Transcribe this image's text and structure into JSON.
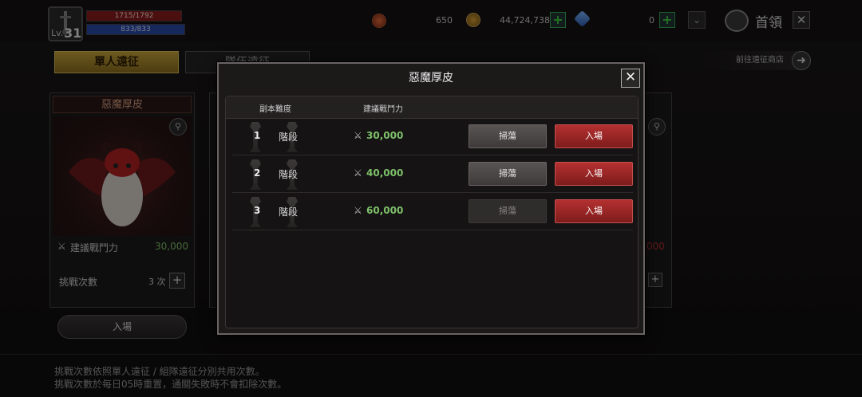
{
  "player": {
    "level_prefix": "Lv.",
    "level": "31",
    "hp": "1715/1792",
    "mp": "833/833"
  },
  "resources": [
    {
      "icon": "red-token-icon",
      "value": "650"
    },
    {
      "icon": "gold-coin-icon",
      "value": "44,724,738"
    },
    {
      "icon": "diamond-icon",
      "value": "0"
    }
  ],
  "header": {
    "home_label": "首領",
    "close_glyph": "✕"
  },
  "tabs": {
    "active": "單人遠征",
    "inactive": "隊伍遠征"
  },
  "shop_link": "前往遠征商店",
  "card": {
    "title": "惡魔厚皮",
    "power_label": "建議戰鬥力",
    "power_value": "30,000",
    "challenge_label": "挑戰次數",
    "challenge_value": "3 次",
    "enter_label": "入場"
  },
  "card3_power": "000",
  "footer_notes": [
    "挑戰次數依照單人遠征 / 組隊遠征分別共用次數。",
    "挑戰次數於每日05時重置，通關失敗時不會扣除次數。"
  ],
  "modal": {
    "title": "惡魔厚皮",
    "close_glyph": "✕",
    "headers": {
      "difficulty": "副本難度",
      "power": "建議戰鬥力"
    },
    "rows": [
      {
        "num": "1",
        "label": "階段",
        "power": "30,000",
        "sweep": "掃蕩",
        "enter": "入場",
        "sweep_enabled": true
      },
      {
        "num": "2",
        "label": "階段",
        "power": "40,000",
        "sweep": "掃蕩",
        "enter": "入場",
        "sweep_enabled": true
      },
      {
        "num": "3",
        "label": "階段",
        "power": "60,000",
        "sweep": "掃蕩",
        "enter": "入場",
        "sweep_enabled": false
      }
    ]
  },
  "colors": {
    "power_green": "#7ec06a",
    "enter_red": "#b43030",
    "tab_gold": "#c6a43a"
  }
}
